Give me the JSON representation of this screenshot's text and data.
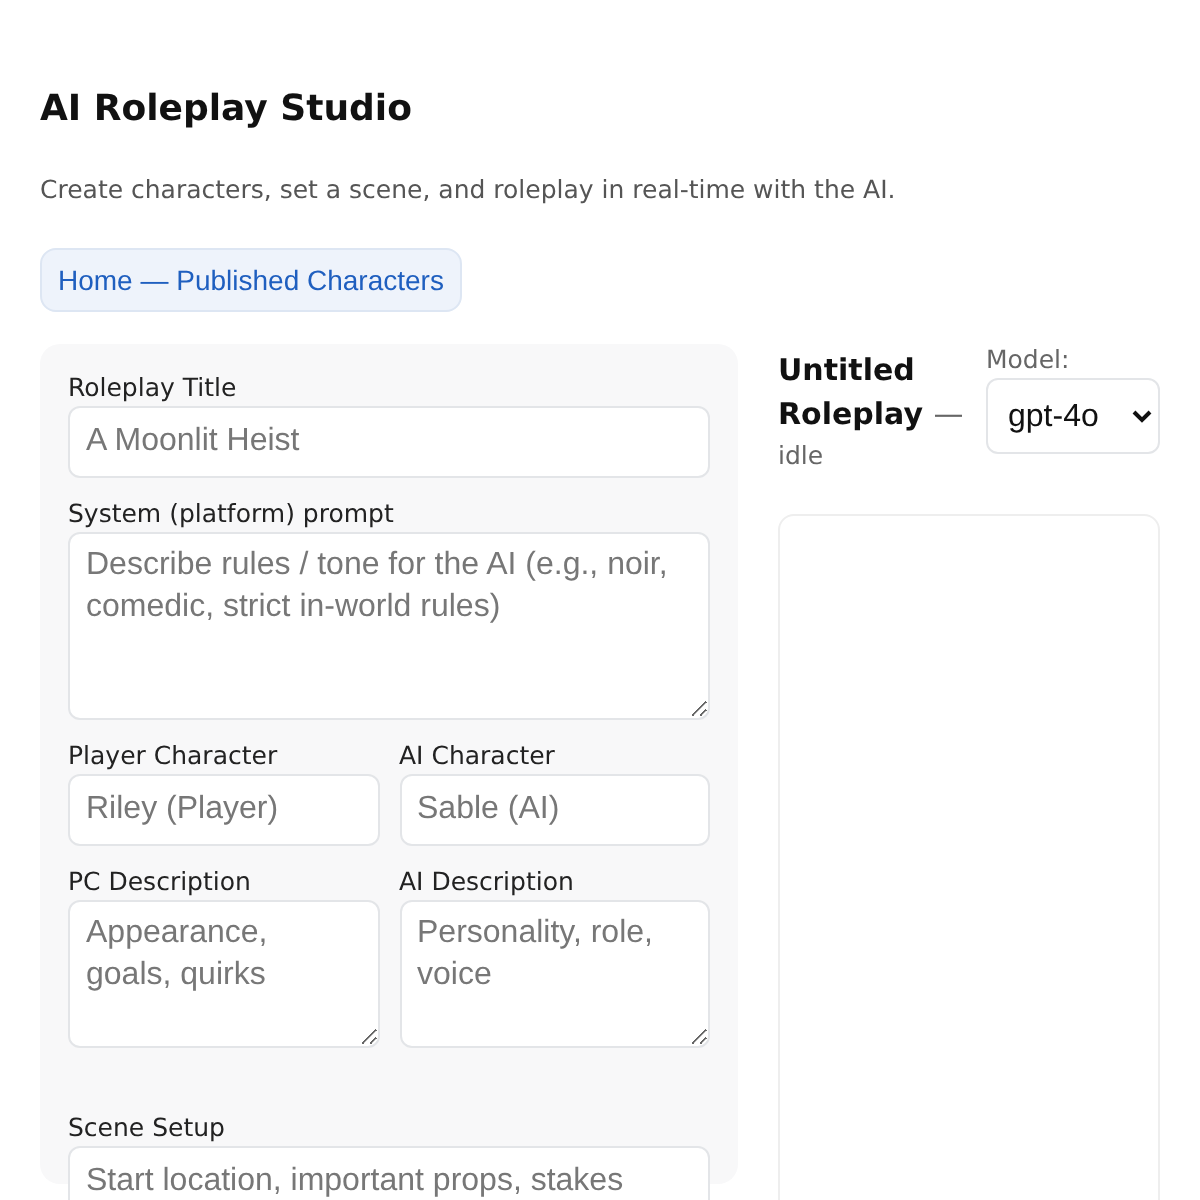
{
  "header": {
    "title": "AI Roleplay Studio",
    "subtitle": "Create characters, set a scene, and roleplay in real-time with the AI."
  },
  "nav_link": "Home — Published Characters",
  "form": {
    "rows": [
      {
        "fields": [
          {
            "kind": "input",
            "label": "Roleplay Title",
            "placeholder": "A Moonlit Heist"
          }
        ]
      },
      {
        "fields": [
          {
            "kind": "textarea",
            "label": "System (platform) prompt",
            "placeholder": "Describe rules / tone for the AI (e.g., noir, comedic, strict in-world rules)"
          }
        ]
      },
      {
        "fields": [
          {
            "kind": "input",
            "label": "Player Character",
            "placeholder": "Riley (Player)"
          },
          {
            "kind": "input",
            "label": "AI Character",
            "placeholder": "Sable (AI)"
          }
        ]
      },
      {
        "fields": [
          {
            "kind": "textarea",
            "label": "PC Description",
            "placeholder": "Appearance, goals, quirks"
          },
          {
            "kind": "textarea",
            "label": "AI Description",
            "placeholder": "Personality, role, voice"
          }
        ]
      },
      {
        "fields": [
          {
            "kind": "input",
            "label": "Scene Setup",
            "placeholder": "Start location, important props, stakes"
          }
        ]
      }
    ]
  },
  "session": {
    "title": "Untitled Roleplay",
    "separator": "—",
    "status": "idle",
    "model_label": "Model:",
    "model": "gpt-4o"
  }
}
